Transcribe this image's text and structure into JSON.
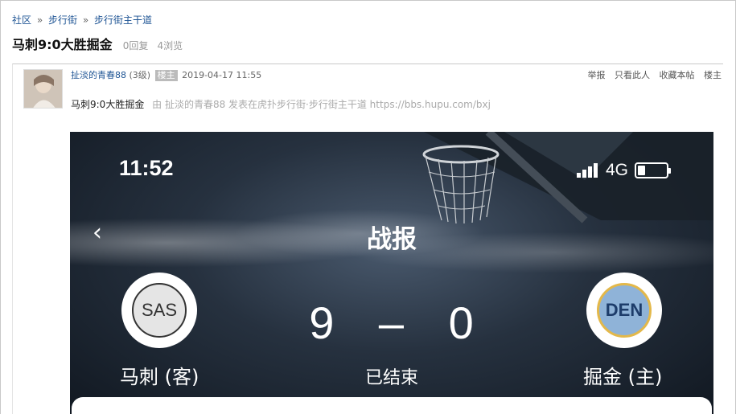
{
  "breadcrumb": {
    "items": [
      "社区",
      "步行街",
      "步行街主干道"
    ],
    "separator": "»"
  },
  "thread": {
    "title": "马刺9:0大胜掘金",
    "replies": "0回复",
    "views": "4浏览"
  },
  "post": {
    "author": "扯淡的青春88",
    "level": "(3级)",
    "badge": "楼主",
    "timestamp": "2019-04-17 11:55",
    "actions": [
      "举报",
      "只看此人",
      "收藏本帖",
      "楼主"
    ],
    "body_title": "马刺9:0大胜掘金",
    "source_text": "由 扯淡的青春88 发表在虎扑步行街·步行街主干道 https://bbs.hupu.com/bxj"
  },
  "screenshot": {
    "time": "11:52",
    "network": "4G",
    "back_icon": "chevron-left-icon",
    "header": "战报",
    "away_logo": "SAS",
    "home_logo": "DEN",
    "away_score": "9",
    "dash": "–",
    "home_score": "0",
    "away_name": "马刺 (客)",
    "home_name": "掘金 (主)",
    "status": "已结束"
  },
  "colors": {
    "link": "#1e5494",
    "muted": "#999999",
    "badge_bg": "#bbbbbb"
  }
}
